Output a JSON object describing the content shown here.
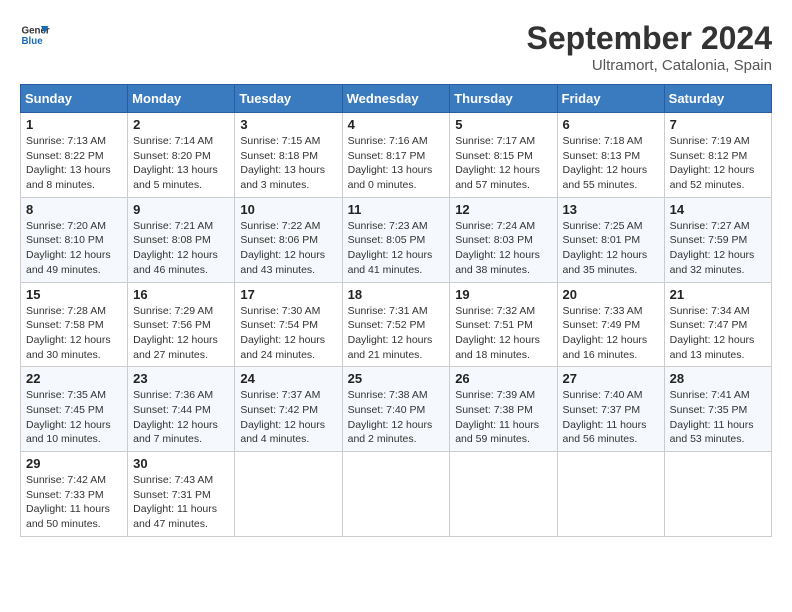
{
  "logo": {
    "line1": "General",
    "line2": "Blue"
  },
  "title": "September 2024",
  "location": "Ultramort, Catalonia, Spain",
  "weekdays": [
    "Sunday",
    "Monday",
    "Tuesday",
    "Wednesday",
    "Thursday",
    "Friday",
    "Saturday"
  ],
  "weeks": [
    [
      {
        "day": "1",
        "sunrise": "7:13 AM",
        "sunset": "8:22 PM",
        "daylight": "13 hours and 8 minutes."
      },
      {
        "day": "2",
        "sunrise": "7:14 AM",
        "sunset": "8:20 PM",
        "daylight": "13 hours and 5 minutes."
      },
      {
        "day": "3",
        "sunrise": "7:15 AM",
        "sunset": "8:18 PM",
        "daylight": "13 hours and 3 minutes."
      },
      {
        "day": "4",
        "sunrise": "7:16 AM",
        "sunset": "8:17 PM",
        "daylight": "13 hours and 0 minutes."
      },
      {
        "day": "5",
        "sunrise": "7:17 AM",
        "sunset": "8:15 PM",
        "daylight": "12 hours and 57 minutes."
      },
      {
        "day": "6",
        "sunrise": "7:18 AM",
        "sunset": "8:13 PM",
        "daylight": "12 hours and 55 minutes."
      },
      {
        "day": "7",
        "sunrise": "7:19 AM",
        "sunset": "8:12 PM",
        "daylight": "12 hours and 52 minutes."
      }
    ],
    [
      {
        "day": "8",
        "sunrise": "7:20 AM",
        "sunset": "8:10 PM",
        "daylight": "12 hours and 49 minutes."
      },
      {
        "day": "9",
        "sunrise": "7:21 AM",
        "sunset": "8:08 PM",
        "daylight": "12 hours and 46 minutes."
      },
      {
        "day": "10",
        "sunrise": "7:22 AM",
        "sunset": "8:06 PM",
        "daylight": "12 hours and 43 minutes."
      },
      {
        "day": "11",
        "sunrise": "7:23 AM",
        "sunset": "8:05 PM",
        "daylight": "12 hours and 41 minutes."
      },
      {
        "day": "12",
        "sunrise": "7:24 AM",
        "sunset": "8:03 PM",
        "daylight": "12 hours and 38 minutes."
      },
      {
        "day": "13",
        "sunrise": "7:25 AM",
        "sunset": "8:01 PM",
        "daylight": "12 hours and 35 minutes."
      },
      {
        "day": "14",
        "sunrise": "7:27 AM",
        "sunset": "7:59 PM",
        "daylight": "12 hours and 32 minutes."
      }
    ],
    [
      {
        "day": "15",
        "sunrise": "7:28 AM",
        "sunset": "7:58 PM",
        "daylight": "12 hours and 30 minutes."
      },
      {
        "day": "16",
        "sunrise": "7:29 AM",
        "sunset": "7:56 PM",
        "daylight": "12 hours and 27 minutes."
      },
      {
        "day": "17",
        "sunrise": "7:30 AM",
        "sunset": "7:54 PM",
        "daylight": "12 hours and 24 minutes."
      },
      {
        "day": "18",
        "sunrise": "7:31 AM",
        "sunset": "7:52 PM",
        "daylight": "12 hours and 21 minutes."
      },
      {
        "day": "19",
        "sunrise": "7:32 AM",
        "sunset": "7:51 PM",
        "daylight": "12 hours and 18 minutes."
      },
      {
        "day": "20",
        "sunrise": "7:33 AM",
        "sunset": "7:49 PM",
        "daylight": "12 hours and 16 minutes."
      },
      {
        "day": "21",
        "sunrise": "7:34 AM",
        "sunset": "7:47 PM",
        "daylight": "12 hours and 13 minutes."
      }
    ],
    [
      {
        "day": "22",
        "sunrise": "7:35 AM",
        "sunset": "7:45 PM",
        "daylight": "12 hours and 10 minutes."
      },
      {
        "day": "23",
        "sunrise": "7:36 AM",
        "sunset": "7:44 PM",
        "daylight": "12 hours and 7 minutes."
      },
      {
        "day": "24",
        "sunrise": "7:37 AM",
        "sunset": "7:42 PM",
        "daylight": "12 hours and 4 minutes."
      },
      {
        "day": "25",
        "sunrise": "7:38 AM",
        "sunset": "7:40 PM",
        "daylight": "12 hours and 2 minutes."
      },
      {
        "day": "26",
        "sunrise": "7:39 AM",
        "sunset": "7:38 PM",
        "daylight": "11 hours and 59 minutes."
      },
      {
        "day": "27",
        "sunrise": "7:40 AM",
        "sunset": "7:37 PM",
        "daylight": "11 hours and 56 minutes."
      },
      {
        "day": "28",
        "sunrise": "7:41 AM",
        "sunset": "7:35 PM",
        "daylight": "11 hours and 53 minutes."
      }
    ],
    [
      {
        "day": "29",
        "sunrise": "7:42 AM",
        "sunset": "7:33 PM",
        "daylight": "11 hours and 50 minutes."
      },
      {
        "day": "30",
        "sunrise": "7:43 AM",
        "sunset": "7:31 PM",
        "daylight": "11 hours and 47 minutes."
      },
      null,
      null,
      null,
      null,
      null
    ]
  ],
  "labels": {
    "sunrise": "Sunrise:",
    "sunset": "Sunset:",
    "daylight": "Daylight:"
  }
}
